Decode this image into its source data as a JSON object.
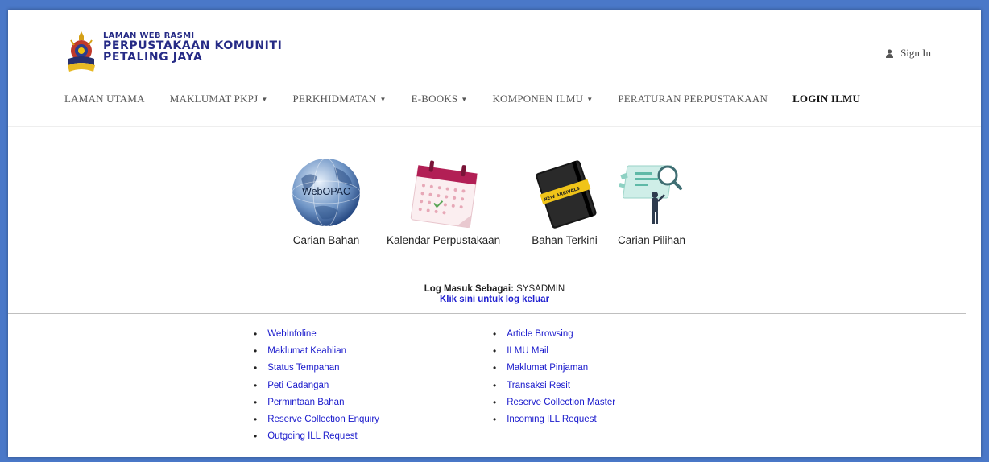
{
  "logo": {
    "line1": "LAMAN WEB RASMI",
    "line2": "PERPUSTAKAAN KOMUNITI",
    "line3": "PETALING JAYA"
  },
  "signin": {
    "label": "Sign In",
    "icon": "user-icon"
  },
  "nav": [
    {
      "label": "LAMAN UTAMA",
      "dropdown": false
    },
    {
      "label": "MAKLUMAT PKPJ",
      "dropdown": true
    },
    {
      "label": "PERKHIDMATAN",
      "dropdown": true
    },
    {
      "label": "E-BOOKS",
      "dropdown": true
    },
    {
      "label": "KOMPONEN ILMU",
      "dropdown": true
    },
    {
      "label": "PERATURAN PERPUSTAKAAN",
      "dropdown": false
    },
    {
      "label": "LOGIN ILMU",
      "dropdown": false,
      "active": true
    }
  ],
  "tiles": [
    {
      "label": "Carian Bahan",
      "icon": "webopac-globe-icon",
      "globe_text": "WebOPAC"
    },
    {
      "label": "Kalendar Perpustakaan",
      "icon": "calendar-icon"
    },
    {
      "label": "Bahan Terkini",
      "icon": "notebook-icon",
      "book_band": "NEW ARRIVALS"
    },
    {
      "label": "Carian Pilihan",
      "icon": "search-person-icon"
    }
  ],
  "login": {
    "prefix": "Log Masuk Sebagai:",
    "user": "SYSADMIN",
    "logout": "Klik sini untuk log keluar"
  },
  "links_left": [
    "WebInfoline",
    "Maklumat Keahlian",
    "Status Tempahan",
    "Peti Cadangan",
    "Permintaan Bahan",
    "Reserve Collection Enquiry",
    "Outgoing ILL Request"
  ],
  "links_right": [
    "Article Browsing",
    "ILMU Mail",
    "Maklumat Pinjaman",
    "Transaksi Resit",
    "Reserve Collection Master",
    "Incoming ILL Request"
  ],
  "colors": {
    "page_border": "#4a78c8",
    "logo_text": "#262b86",
    "link": "#1a1acc"
  }
}
